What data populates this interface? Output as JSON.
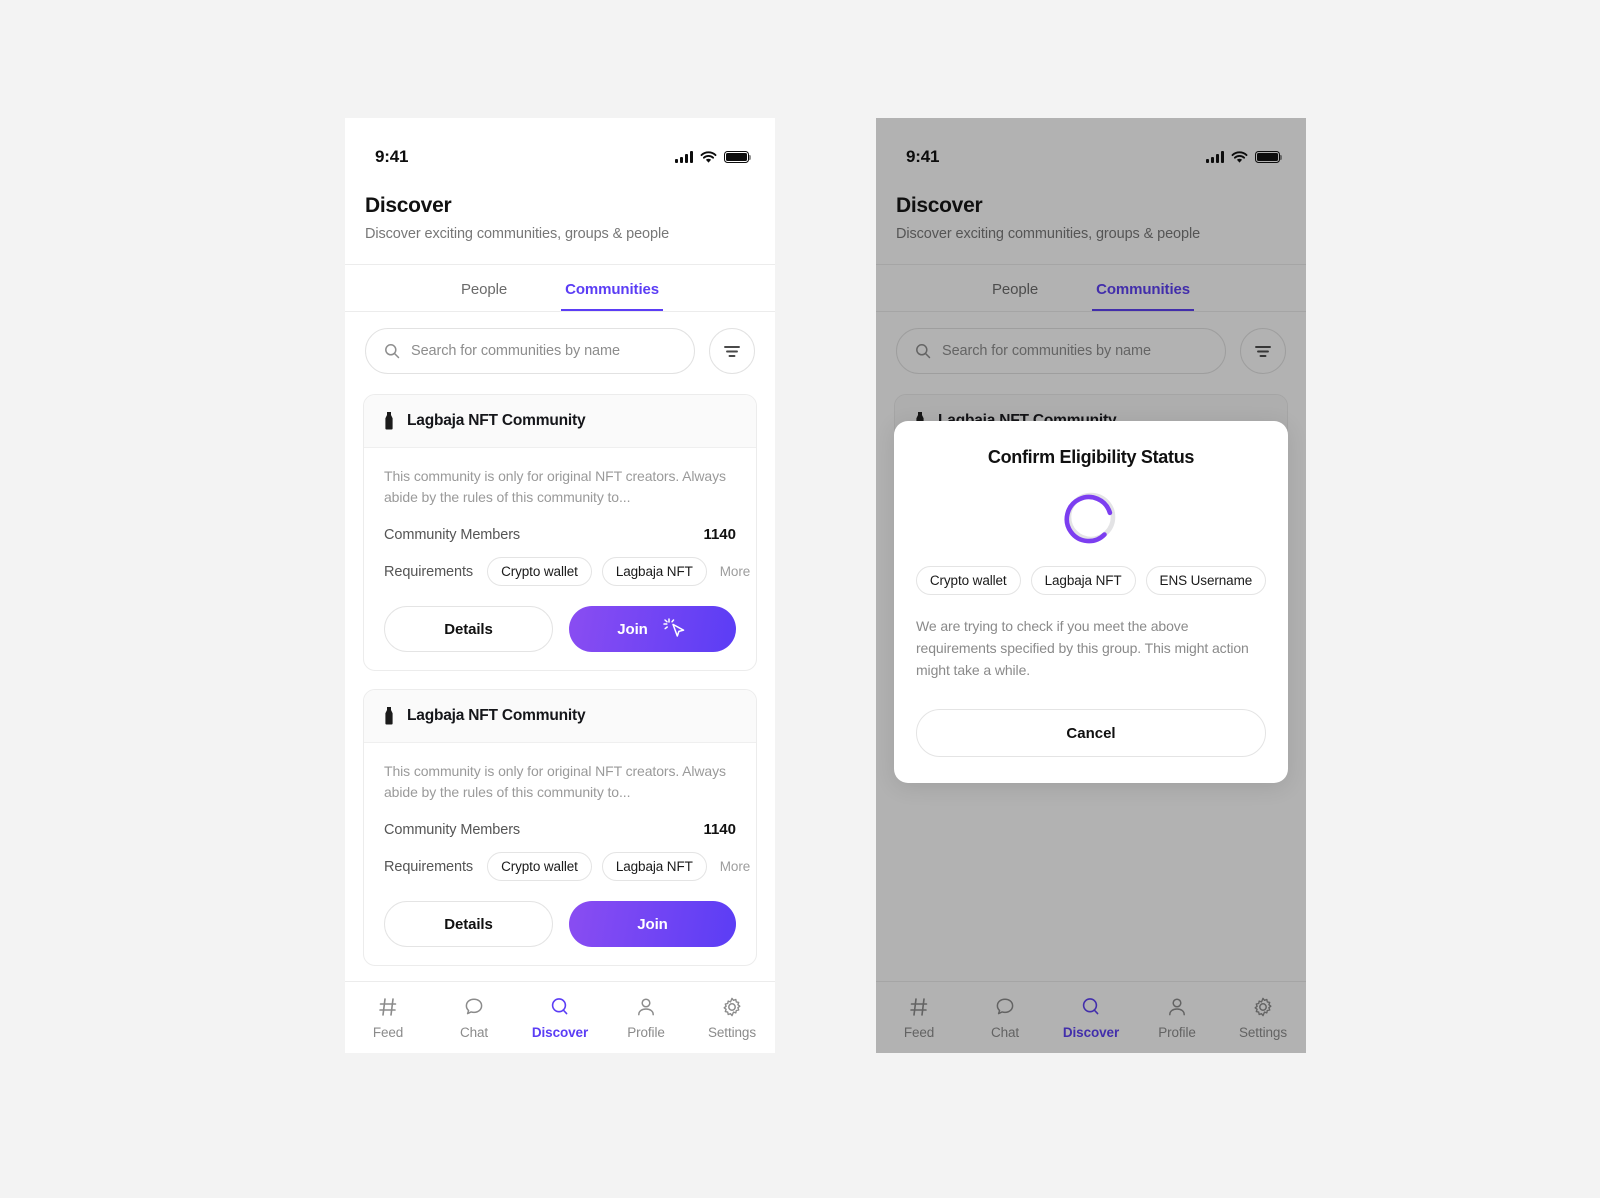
{
  "status_bar": {
    "time": "9:41",
    "signal_icon": "cellular-bars-icon",
    "wifi_icon": "wifi-icon",
    "battery_icon": "battery-full-icon"
  },
  "header": {
    "title": "Discover",
    "subtitle": "Discover exciting communities, groups & people"
  },
  "tabs": [
    {
      "label": "People",
      "active": false
    },
    {
      "label": "Communities",
      "active": true
    }
  ],
  "search": {
    "placeholder": "Search for communities by name",
    "value": "",
    "icon": "search-icon"
  },
  "filter": {
    "icon": "filter-icon"
  },
  "cards": [
    {
      "icon": "community-badge-icon",
      "name": "Lagbaja NFT Community",
      "description": "This community is only for original NFT creators. Always abide by the rules of this community to...",
      "members_label": "Community Members",
      "members_value": "1140",
      "requirements_label": "Requirements",
      "requirements": [
        "Crypto wallet",
        "Lagbaja NFT"
      ],
      "requirements_more": "More",
      "details_label": "Details",
      "join_label": "Join",
      "cursor_icon": "click-cursor-icon"
    },
    {
      "icon": "community-badge-icon",
      "name": "Lagbaja NFT Community",
      "description": "This community is only for original NFT creators. Always abide by the rules of this community to...",
      "members_label": "Community Members",
      "members_value": "1140",
      "requirements_label": "Requirements",
      "requirements": [
        "Crypto wallet",
        "Lagbaja NFT"
      ],
      "requirements_more": "More",
      "details_label": "Details",
      "join_label": "Join"
    }
  ],
  "bottom_nav": [
    {
      "label": "Feed",
      "icon": "hash-icon",
      "active": false
    },
    {
      "label": "Chat",
      "icon": "chat-bubble-icon",
      "active": false
    },
    {
      "label": "Discover",
      "icon": "search-icon",
      "active": true
    },
    {
      "label": "Profile",
      "icon": "person-icon",
      "active": false
    },
    {
      "label": "Settings",
      "icon": "gear-icon",
      "active": false
    }
  ],
  "modal": {
    "title": "Confirm Eligibility Status",
    "spinner_icon": "loading-spinner-icon",
    "chips": [
      "Crypto wallet",
      "Lagbaja NFT",
      "ENS Username"
    ],
    "body": "We are trying to check if you meet the above requirements specified by this group. This might action might take a while.",
    "cancel_label": "Cancel"
  },
  "colors": {
    "accent": "#5b3df5",
    "accent_gradient_start": "#8a4df2",
    "spinner_track": "#e3e3e5",
    "page_background": "#f3f3f3",
    "scrim": "rgba(17,17,17,0.32)"
  }
}
